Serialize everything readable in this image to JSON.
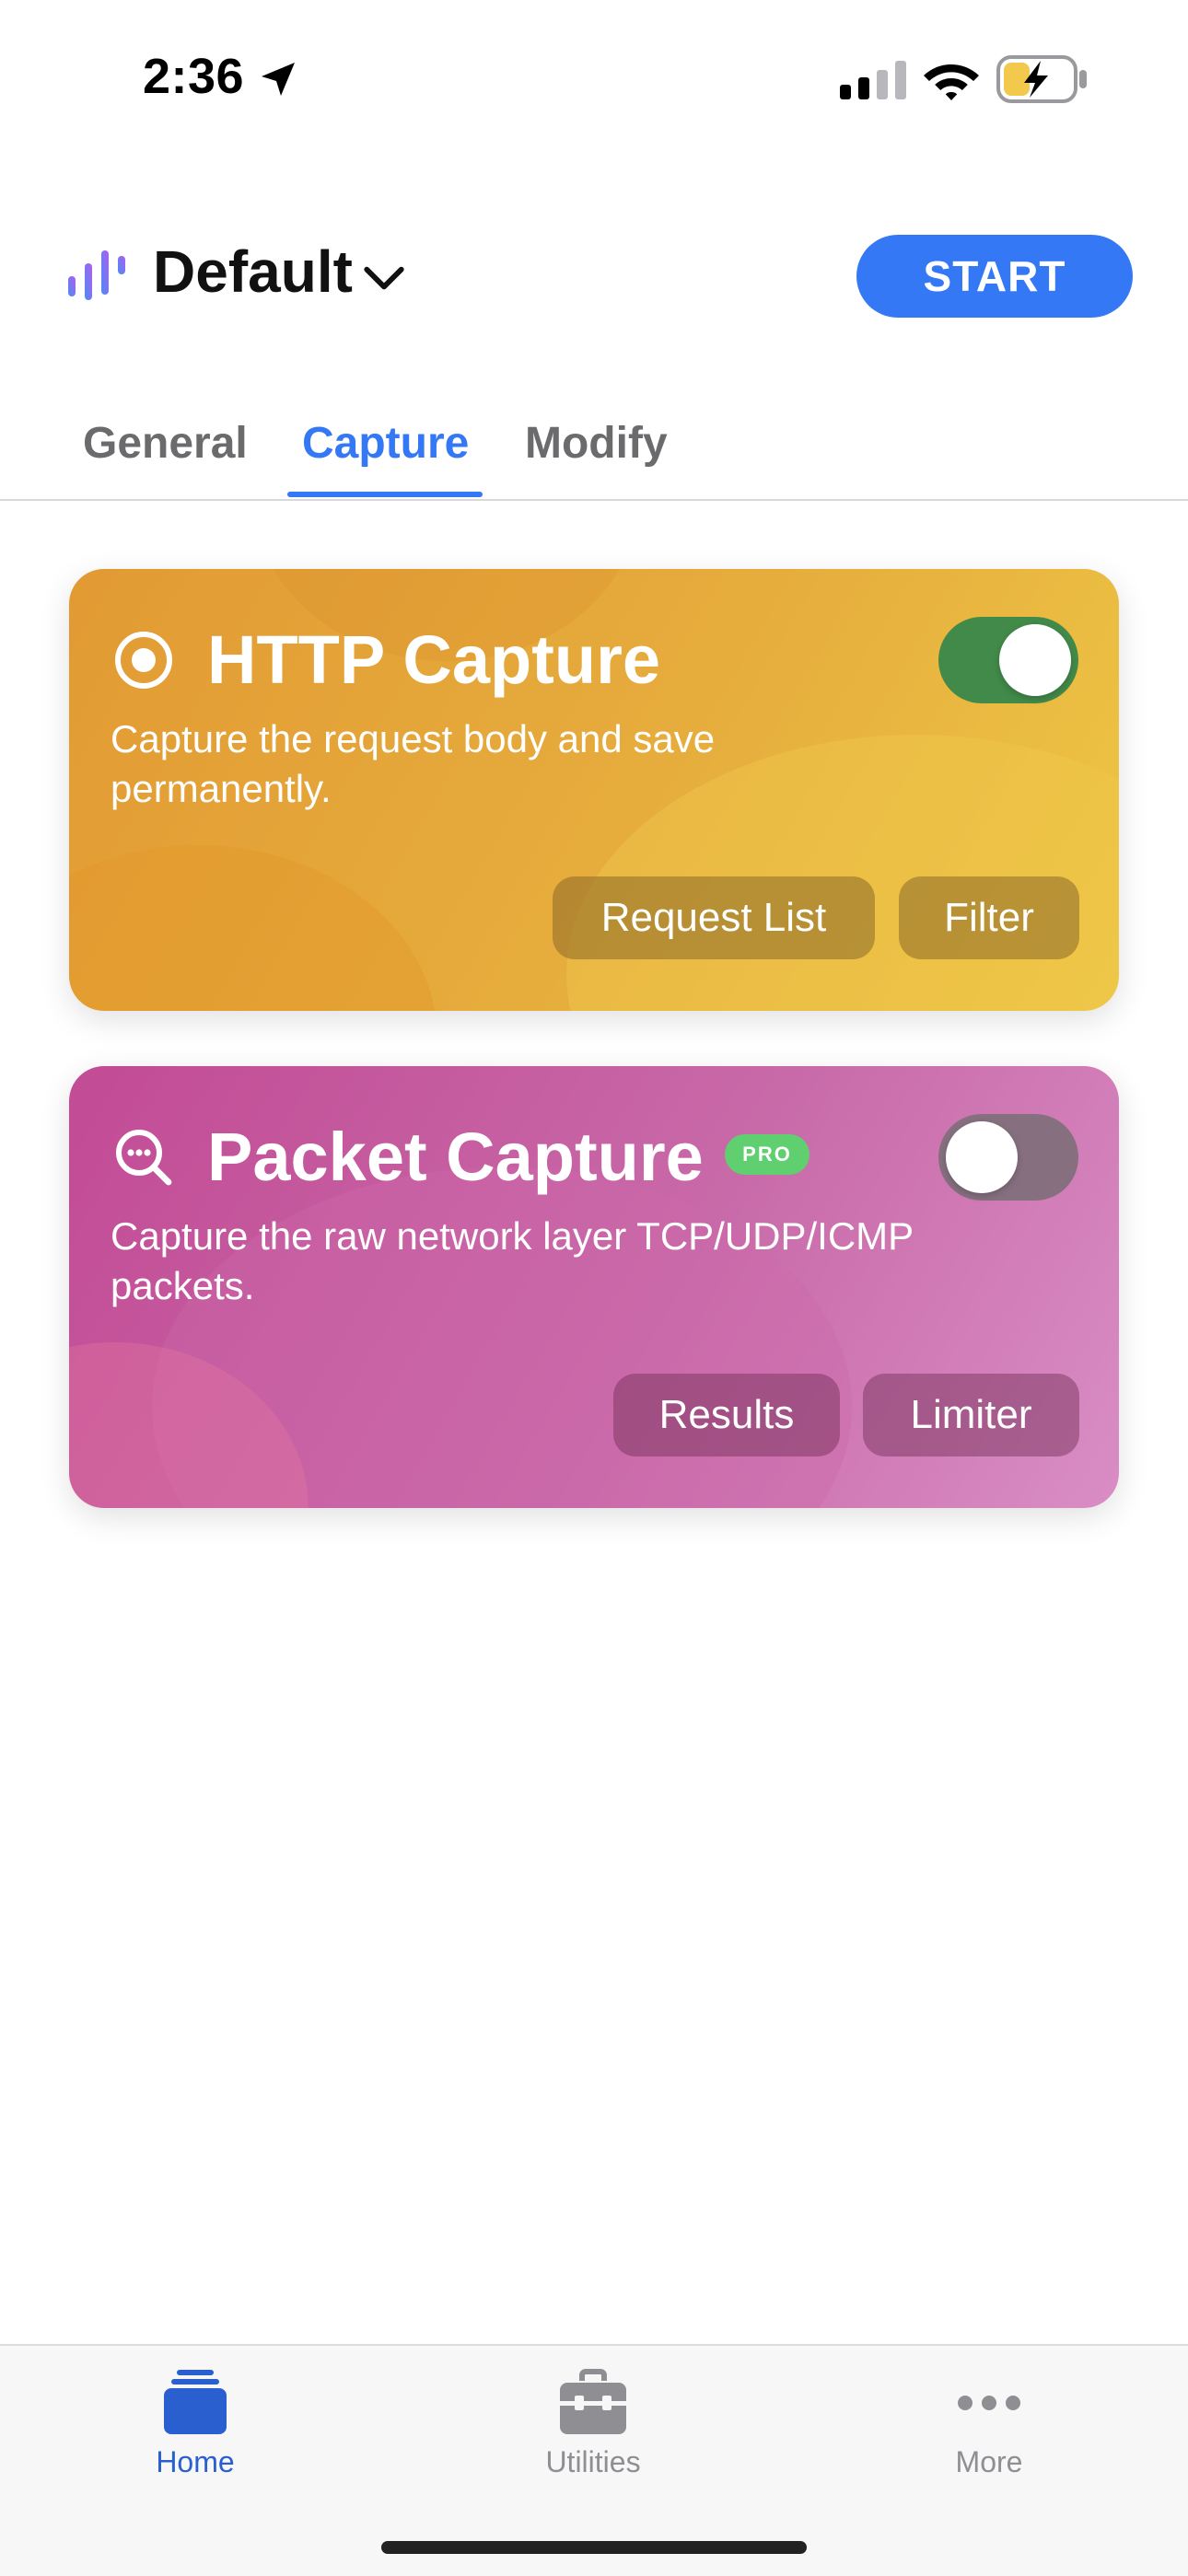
{
  "status_bar": {
    "time": "2:36",
    "icons": [
      "location-arrow-icon",
      "cellular-signal-icon",
      "wifi-icon",
      "battery-charging-icon"
    ]
  },
  "header": {
    "profile_name": "Default",
    "start_label": "START",
    "logo_icon": "waveform-bars-icon",
    "accent_color": "#3478f6"
  },
  "tabs": [
    {
      "label": "General",
      "active": false
    },
    {
      "label": "Capture",
      "active": true
    },
    {
      "label": "Modify",
      "active": false
    }
  ],
  "cards": {
    "http_capture": {
      "icon": "record-target-icon",
      "title": "HTTP Capture",
      "description": "Capture the request body and save permanently.",
      "enabled": true,
      "buttons": [
        "Request List",
        "Filter"
      ],
      "color": "#e6ad3d"
    },
    "packet_capture": {
      "icon": "magnifier-dots-icon",
      "title": "Packet Capture",
      "badge": "PRO",
      "description": "Capture the raw network layer TCP/UDP/ICMP packets.",
      "enabled": false,
      "buttons": [
        "Results",
        "Limiter"
      ],
      "color": "#c869a8"
    }
  },
  "tab_bar": {
    "items": [
      {
        "label": "Home",
        "icon": "home-stack-icon",
        "active": true
      },
      {
        "label": "Utilities",
        "icon": "toolbox-icon",
        "active": false
      },
      {
        "label": "More",
        "icon": "ellipsis-icon",
        "active": false
      }
    ]
  }
}
